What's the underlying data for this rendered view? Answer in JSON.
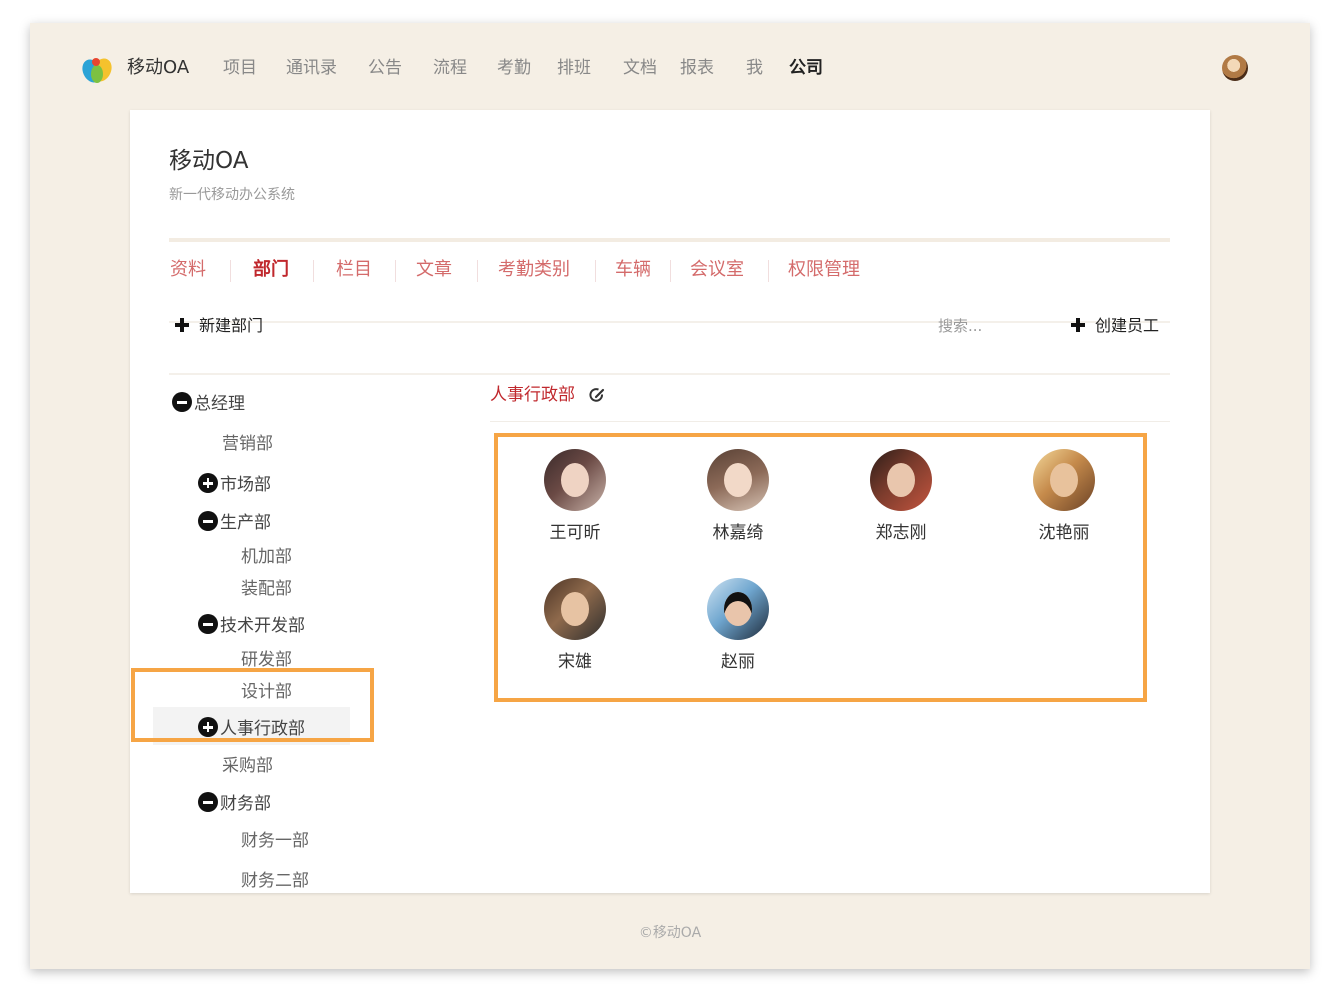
{
  "brand": {
    "name": "移动OA"
  },
  "nav": [
    {
      "label": "项目"
    },
    {
      "label": "通讯录"
    },
    {
      "label": "公告"
    },
    {
      "label": "流程"
    },
    {
      "label": "考勤"
    },
    {
      "label": "排班"
    },
    {
      "label": "文档"
    },
    {
      "label": "报表"
    },
    {
      "label": "我"
    },
    {
      "label": "公司",
      "active": true
    }
  ],
  "company": {
    "title": "移动OA",
    "subtitle": "新一代移动办公系统"
  },
  "tabs": [
    {
      "label": "资料"
    },
    {
      "label": "部门",
      "active": true
    },
    {
      "label": "栏目"
    },
    {
      "label": "文章"
    },
    {
      "label": "考勤类别"
    },
    {
      "label": "车辆"
    },
    {
      "label": "会议室"
    },
    {
      "label": "权限管理"
    }
  ],
  "toolbar": {
    "new_dept_label": "新建部门",
    "search_placeholder": "搜索...",
    "create_employee_label": "创建员工"
  },
  "tree": {
    "root": "总经理",
    "marketing": "营销部",
    "market": "市场部",
    "production": "生产部",
    "machining": "机加部",
    "assembly": "装配部",
    "tech_dev": "技术开发部",
    "rnd": "研发部",
    "design": "设计部",
    "hr_admin": "人事行政部",
    "purchase": "采购部",
    "finance": "财务部",
    "finance_1": "财务一部",
    "finance_2": "财务二部"
  },
  "dept_detail": {
    "title": "人事行政部",
    "members": [
      {
        "name": "王可昕"
      },
      {
        "name": "林嘉绮"
      },
      {
        "name": "郑志刚"
      },
      {
        "name": "沈艳丽"
      },
      {
        "name": "宋雄"
      },
      {
        "name": "赵丽"
      }
    ]
  },
  "footer": {
    "copyright": "©移动OA"
  },
  "colors": {
    "accent": "#c0282d",
    "tab_text": "#d46b6b",
    "highlight": "#f6a545",
    "frame_bg": "#f5efe5"
  }
}
